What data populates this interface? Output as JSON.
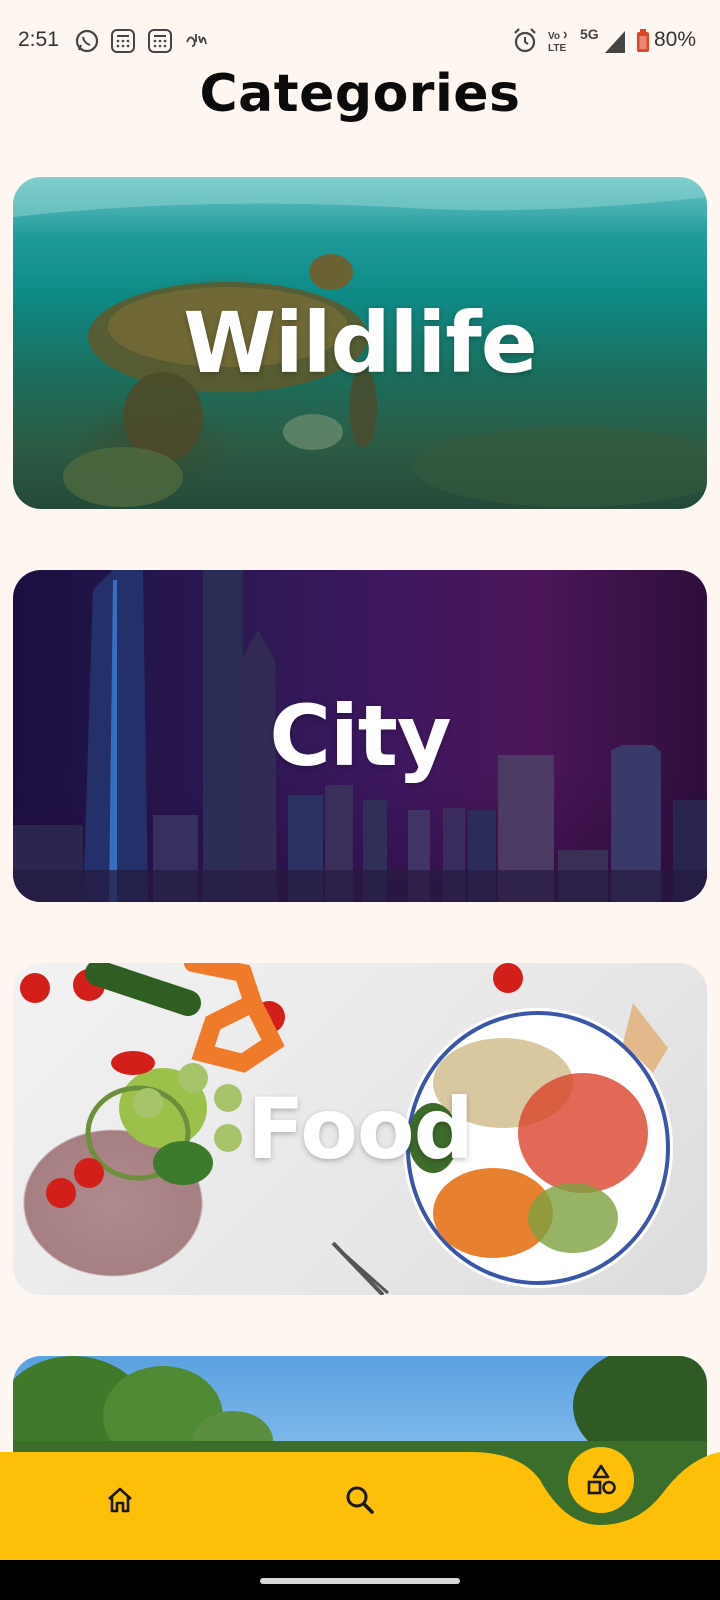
{
  "status_bar": {
    "time": "2:51",
    "battery": "80%",
    "network": "5G",
    "volte": "Vo LTE",
    "icons": [
      "whatsapp-icon",
      "calculator-icon",
      "calculator-icon",
      "script-icon",
      "alarm-icon",
      "volte-icon",
      "signal-icon",
      "battery-icon"
    ]
  },
  "header": {
    "title": "Categories"
  },
  "categories": [
    {
      "label": "Wildlife"
    },
    {
      "label": "City"
    },
    {
      "label": "Food"
    },
    {
      "label": ""
    }
  ],
  "bottom_nav": {
    "items": [
      "home-icon",
      "search-icon",
      "categories-icon"
    ],
    "active": "categories-icon"
  },
  "colors": {
    "background": "#fdf6f1",
    "accent": "#fdbf08",
    "title": "#0b0b0b",
    "card_text": "#ffffff"
  }
}
